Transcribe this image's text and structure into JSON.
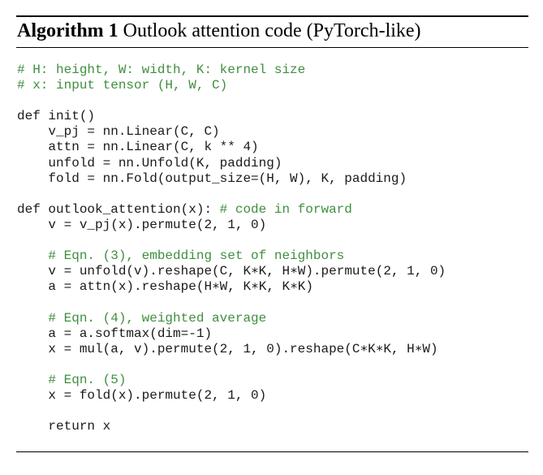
{
  "caption": {
    "label": "Algorithm 1",
    "title": "Outlook attention code (PyTorch-like)"
  },
  "colors": {
    "comment": "#3f8f3f",
    "code": "#1a1a1a",
    "rule": "#000000"
  },
  "code_lines": [
    {
      "indent": "",
      "code": "",
      "comment": "# H: height, W: width, K: kernel size"
    },
    {
      "indent": "",
      "code": "",
      "comment": "# x: input tensor (H, W, C)"
    },
    {
      "indent": "",
      "code": "",
      "comment": ""
    },
    {
      "indent": "",
      "code": "def init()",
      "comment": ""
    },
    {
      "indent": "    ",
      "code": "v_pj = nn.Linear(C, C)",
      "comment": ""
    },
    {
      "indent": "    ",
      "code": "attn = nn.Linear(C, k ** 4)",
      "comment": ""
    },
    {
      "indent": "    ",
      "code": "unfold = nn.Unfold(K, padding)",
      "comment": ""
    },
    {
      "indent": "    ",
      "code": "fold = nn.Fold(output_size=(H, W), K, padding)",
      "comment": ""
    },
    {
      "indent": "",
      "code": "",
      "comment": ""
    },
    {
      "indent": "",
      "code": "def outlook_attention(x): ",
      "comment": "# code in forward"
    },
    {
      "indent": "    ",
      "code": "v = v_pj(x).permute(2, 1, 0)",
      "comment": ""
    },
    {
      "indent": "",
      "code": "",
      "comment": ""
    },
    {
      "indent": "    ",
      "code": "",
      "comment": "# Eqn. (3), embedding set of neighbors"
    },
    {
      "indent": "    ",
      "code": "v = unfold(v).reshape(C, K∗K, H∗W).permute(2, 1, 0)",
      "comment": ""
    },
    {
      "indent": "    ",
      "code": "a = attn(x).reshape(H∗W, K∗K, K∗K)",
      "comment": ""
    },
    {
      "indent": "",
      "code": "",
      "comment": ""
    },
    {
      "indent": "    ",
      "code": "",
      "comment": "# Eqn. (4), weighted average"
    },
    {
      "indent": "    ",
      "code": "a = a.softmax(dim=-1)",
      "comment": ""
    },
    {
      "indent": "    ",
      "code": "x = mul(a, v).permute(2, 1, 0).reshape(C∗K∗K, H∗W)",
      "comment": ""
    },
    {
      "indent": "",
      "code": "",
      "comment": ""
    },
    {
      "indent": "    ",
      "code": "",
      "comment": "# Eqn. (5)"
    },
    {
      "indent": "    ",
      "code": "x = fold(x).permute(2, 1, 0)",
      "comment": ""
    },
    {
      "indent": "",
      "code": "",
      "comment": ""
    },
    {
      "indent": "    ",
      "code": "return x",
      "comment": ""
    }
  ]
}
